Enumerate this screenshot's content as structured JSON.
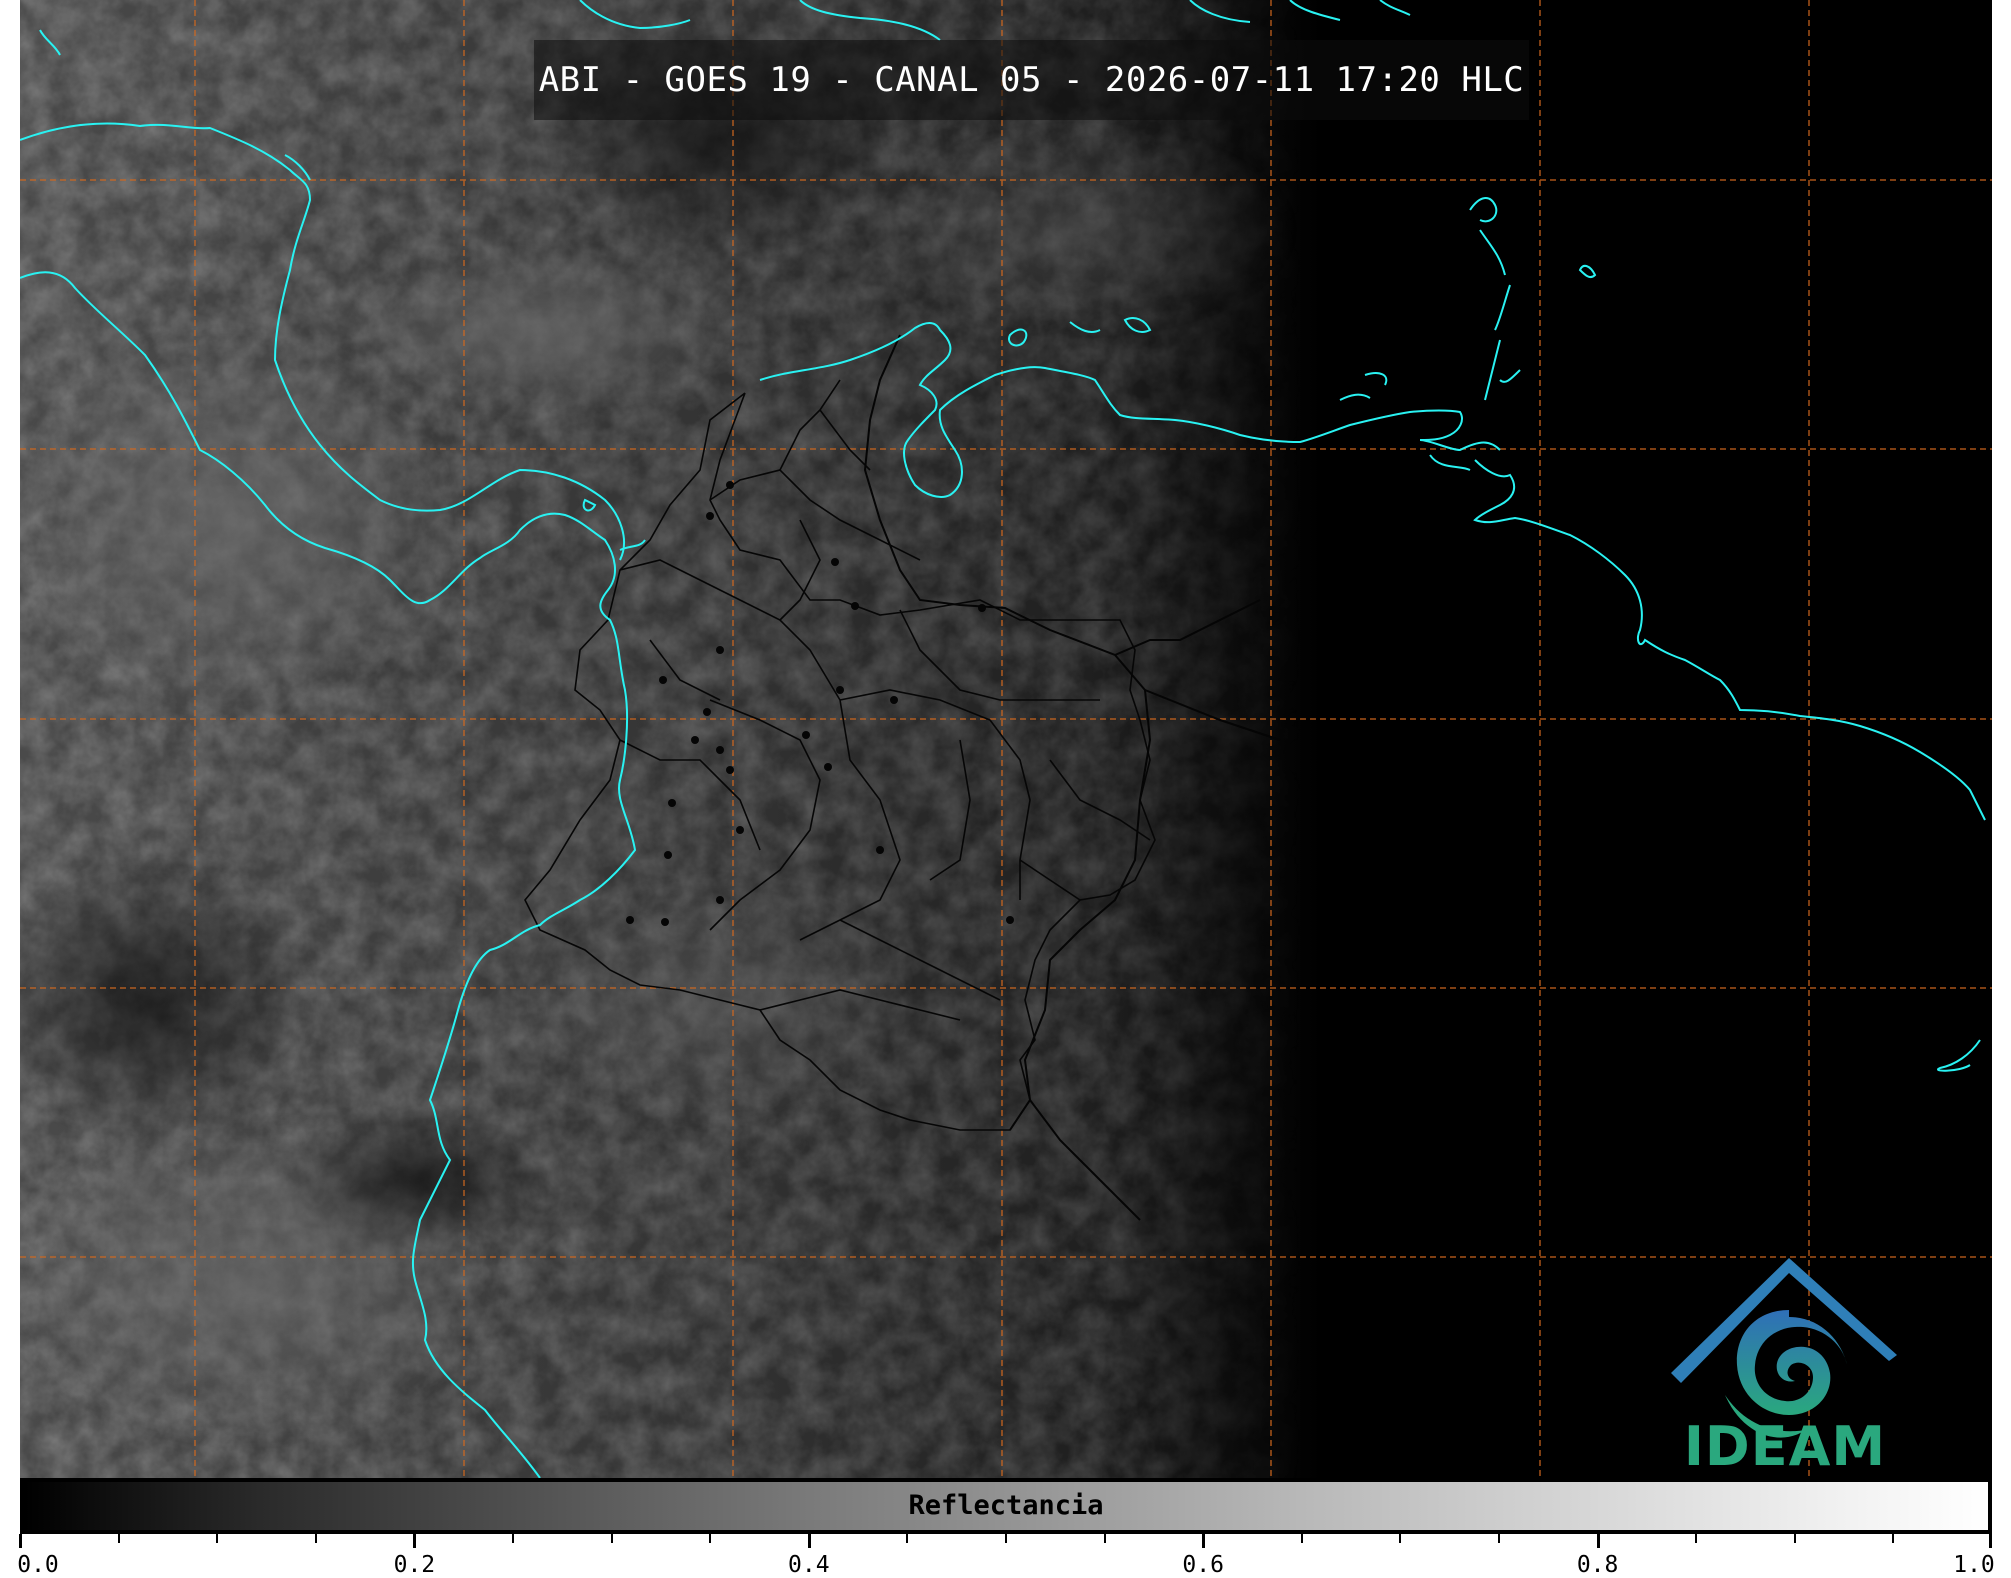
{
  "title": "ABI - GOES 19 - CANAL 05 - 2026-07-11 17:20 HLC",
  "colorbar": {
    "label": "Reflectancia",
    "range": [
      0.0,
      1.0
    ],
    "ticks": [
      "0.0",
      "0.2",
      "0.4",
      "0.6",
      "0.8",
      "1.0"
    ]
  },
  "logo": {
    "text": "IDEAM"
  },
  "colors": {
    "coastline": "#29f2f2",
    "gridline": "#d2691e",
    "borders": "#0a0a0a",
    "logo_blue": "#2f7fb8",
    "logo_green": "#2aa87e"
  },
  "map": {
    "layers": [
      "satellite-reflectance",
      "coastlines",
      "country-borders",
      "department-borders",
      "lat-lon-grid"
    ],
    "grid": true
  }
}
